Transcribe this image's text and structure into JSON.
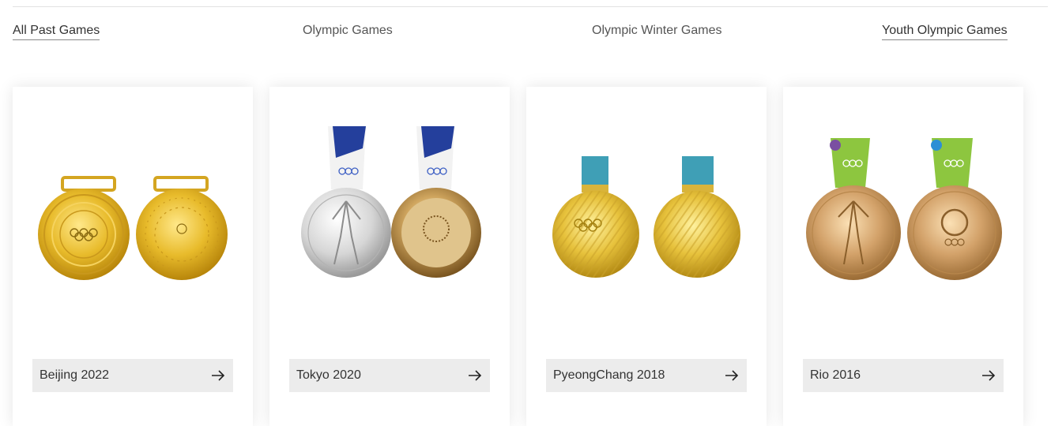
{
  "filters": {
    "all": "All Past Games",
    "olympic": "Olympic Games",
    "winter": "Olympic Winter Games",
    "youth": "Youth Olympic Games"
  },
  "cards": [
    {
      "label": "Beijing 2022",
      "icon": "arrow-right-icon"
    },
    {
      "label": "Tokyo 2020",
      "icon": "arrow-right-icon"
    },
    {
      "label": "PyeongChang 2018",
      "icon": "arrow-right-icon"
    },
    {
      "label": "Rio 2016",
      "icon": "arrow-right-icon"
    }
  ],
  "colors": {
    "gold": "#d9ad2a",
    "silver": "#c9c9c9",
    "bronze": "#b88a5a",
    "tokyo_ribbon": "#243f9c",
    "pyeongchang_ribbon": "#3f9fb6",
    "rio_ribbon": "#8dc63f"
  }
}
